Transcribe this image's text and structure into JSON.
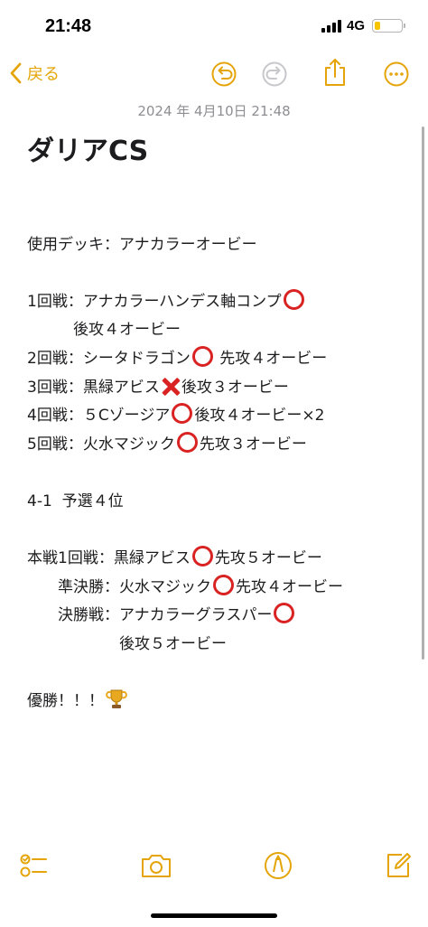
{
  "status_bar": {
    "time": "21:48",
    "network": "4G",
    "battery_level": 0.2,
    "battery_color": "#f7c500",
    "signal_bars": 4
  },
  "nav": {
    "back_label": "戻る",
    "accent_color": "#e5a50a",
    "icons": [
      "chevron-left-icon",
      "undo-icon",
      "redo-icon",
      "share-icon",
      "more-icon"
    ]
  },
  "note": {
    "date": "2024 年 4月10日 21:48",
    "title": "ダリアCS",
    "lines": [
      {
        "text": "",
        "mark": null,
        "rest": ""
      },
      {
        "text": "使用デッキ：アナカラーオービー",
        "mark": null,
        "rest": ""
      },
      {
        "text": "",
        "mark": null,
        "rest": ""
      },
      {
        "text": "1回戦：アナカラーハンデス軸コンプ",
        "mark": "circle",
        "rest": ""
      },
      {
        "text": "　　　後攻４オービー",
        "mark": null,
        "rest": ""
      },
      {
        "text": "2回戦：シータドラゴン",
        "mark": "circle",
        "rest": " 先攻４オービー"
      },
      {
        "text": "3回戦：黒緑アビス",
        "mark": "cross",
        "rest": "後攻３オービー"
      },
      {
        "text": "4回戦：５Cゾージア",
        "mark": "circle",
        "rest": "後攻４オービー×2"
      },
      {
        "text": "5回戦：火水マジック",
        "mark": "circle",
        "rest": "先攻３オービー"
      },
      {
        "text": "",
        "mark": null,
        "rest": ""
      },
      {
        "text": "4-1  予選４位",
        "mark": null,
        "rest": ""
      },
      {
        "text": "",
        "mark": null,
        "rest": ""
      },
      {
        "text": "本戦1回戦：黒緑アビス",
        "mark": "circle",
        "rest": "先攻５オービー"
      },
      {
        "text": "　　準決勝：火水マジック",
        "mark": "circle",
        "rest": "先攻４オービー"
      },
      {
        "text": "　　決勝戦：アナカラーグラスパー",
        "mark": "circle",
        "rest": ""
      },
      {
        "text": "　　　　　　後攻５オービー",
        "mark": null,
        "rest": ""
      },
      {
        "text": "",
        "mark": null,
        "rest": ""
      },
      {
        "text": "優勝！！！",
        "mark": "trophy",
        "rest": ""
      }
    ]
  },
  "toolbar": {
    "icons": [
      "checklist-icon",
      "camera-icon",
      "markup-icon",
      "compose-icon"
    ]
  }
}
